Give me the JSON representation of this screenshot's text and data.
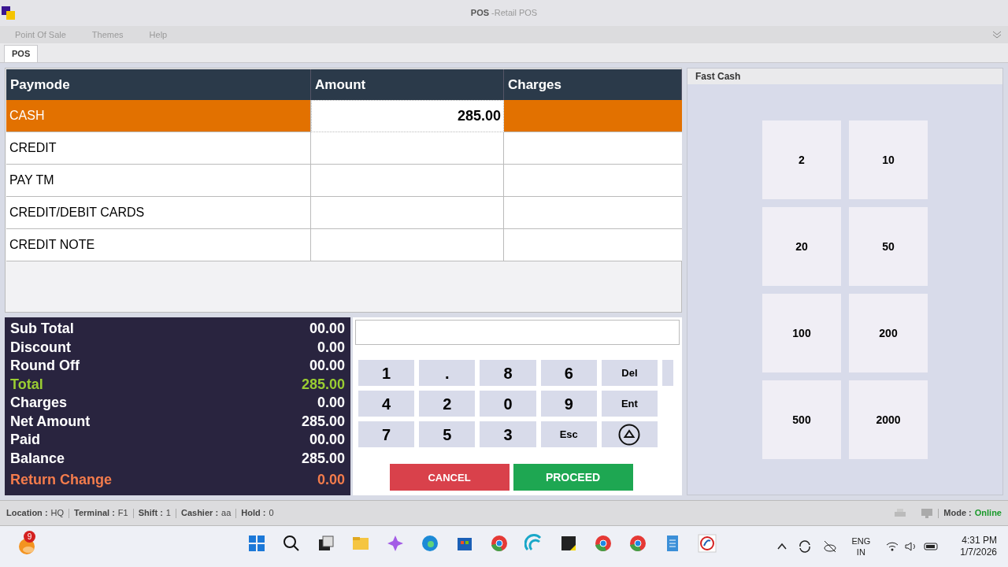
{
  "window": {
    "title": "POS",
    "subtitle": "-Retail POS"
  },
  "menu": [
    {
      "label": "Point Of Sale"
    },
    {
      "label": "Themes"
    },
    {
      "label": "Help"
    }
  ],
  "tabs": [
    {
      "label": "POS",
      "selected": true
    }
  ],
  "table": {
    "columns": [
      "Paymode",
      "Amount",
      "Charges"
    ],
    "rows": [
      {
        "paymode": "CASH",
        "amount": "285.00",
        "selected": true
      },
      {
        "paymode": "CREDIT",
        "selected": false
      },
      {
        "paymode": "PAY TM",
        "selected": false
      },
      {
        "paymode": "CREDIT/DEBIT CARDS",
        "selected": false
      },
      {
        "paymode": "CREDIT NOTE",
        "selected": false
      }
    ]
  },
  "summary": [
    {
      "label": "Sub Total",
      "value": "00.00",
      "color": "#ffffff"
    },
    {
      "label": "Discount",
      "value": "0.00",
      "color": "#ffffff"
    },
    {
      "label": "Round Off",
      "value": "00.00",
      "color": "#ffffff"
    },
    {
      "label": "Total",
      "value": "285.00",
      "color": "#9acd32"
    },
    {
      "label": "Charges",
      "value": "0.00",
      "color": "#ffffff"
    },
    {
      "label": "Net Amount",
      "value": "285.00",
      "color": "#ffffff"
    },
    {
      "label": "Paid",
      "value": "00.00",
      "color": "#ffffff"
    },
    {
      "label": "Balance",
      "value": "285.00",
      "color": "#ffffff"
    },
    {
      "label": "Return Change",
      "value": "0.00",
      "color": "#f47c4c"
    }
  ],
  "keypad": [
    {
      "kind": "digit",
      "label": "1"
    },
    {
      "kind": "digit",
      "label": "."
    },
    {
      "kind": "digit",
      "label": "8"
    },
    {
      "kind": "digit",
      "label": "6"
    },
    {
      "kind": "command",
      "label": "Del"
    },
    {
      "kind": "digit",
      "label": "4"
    },
    {
      "kind": "digit",
      "label": "2"
    },
    {
      "kind": "digit",
      "label": "0"
    },
    {
      "kind": "digit",
      "label": "9"
    },
    {
      "kind": "command",
      "label": "Ent"
    },
    {
      "kind": "digit",
      "label": "7"
    },
    {
      "kind": "digit",
      "label": "5"
    },
    {
      "kind": "digit",
      "label": "3"
    },
    {
      "kind": "command",
      "label": "Esc"
    },
    {
      "kind": "eject"
    }
  ],
  "actions": [
    {
      "kind": "cancel",
      "label": "CANCEL"
    },
    {
      "kind": "proceed",
      "label": "PROCEED"
    }
  ],
  "fast_cash": {
    "title": "Fast Cash",
    "amounts": [
      "2",
      "10",
      "20",
      "50",
      "100",
      "200",
      "500",
      "2000"
    ]
  },
  "status_bar": {
    "fields": [
      {
        "label": "Location :",
        "value": "HQ"
      },
      {
        "label": "Terminal :",
        "value": "F1"
      },
      {
        "label": "Shift :",
        "value": "1"
      },
      {
        "label": "Cashier :",
        "value": "aa"
      },
      {
        "label": "Hold :",
        "value": "0"
      }
    ],
    "mode": {
      "label": "Mode :",
      "value": "Online"
    }
  },
  "taskbar": {
    "weather_badge": "9",
    "language": "ENG",
    "region": "IN",
    "time": "4:31 PM",
    "date": "1/7/2026"
  }
}
